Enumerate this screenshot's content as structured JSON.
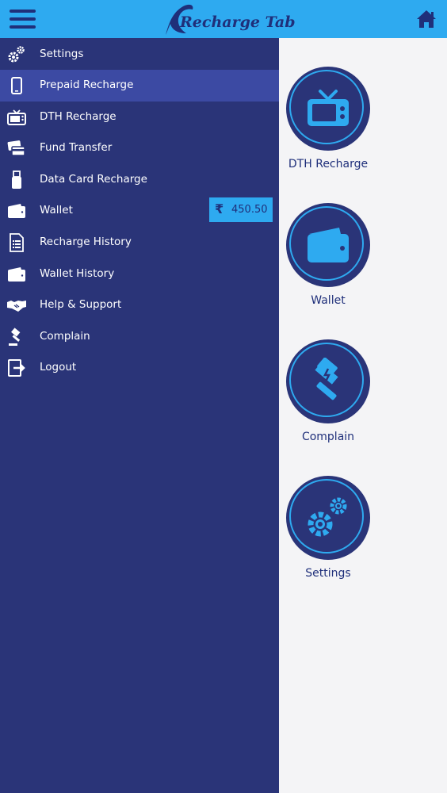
{
  "header": {
    "menu_icon": "hamburger-menu-icon",
    "logo_text": "Recharge Tab",
    "home_icon": "home-icon"
  },
  "drawer": {
    "items": [
      {
        "label": "Settings",
        "icon": "gears-icon"
      },
      {
        "label": "Prepaid Recharge",
        "icon": "mobile-phone-icon",
        "active": true
      },
      {
        "label": "DTH Recharge",
        "icon": "tv-icon"
      },
      {
        "label": "Fund Transfer",
        "icon": "credit-cards-icon"
      },
      {
        "label": "Data Card Recharge",
        "icon": "usb-dongle-icon"
      },
      {
        "label": "Wallet",
        "icon": "wallet-icon"
      },
      {
        "label": "Recharge History",
        "icon": "document-list-icon"
      },
      {
        "label": "Wallet History",
        "icon": "wallet-icon"
      },
      {
        "label": "Help & Support",
        "icon": "handshake-icon"
      },
      {
        "label": "Complain",
        "icon": "gavel-icon"
      },
      {
        "label": "Logout",
        "icon": "logout-icon"
      }
    ],
    "wallet_badge": {
      "currency_symbol": "₹",
      "amount": "450.50"
    }
  },
  "main": {
    "cards": [
      {
        "label": "DTH Recharge",
        "icon": "tv-icon"
      },
      {
        "label": "Wallet",
        "icon": "wallet-icon"
      },
      {
        "label": "Complain",
        "icon": "gavel-icon"
      },
      {
        "label": "Settings",
        "icon": "gears-icon"
      }
    ]
  },
  "colors": {
    "header_bg": "#2eaaf0",
    "drawer_bg": "#2a3478",
    "active_item_bg": "#3c4aa3",
    "accent": "#2eaaf0",
    "content_bg": "#f4f4f6"
  }
}
